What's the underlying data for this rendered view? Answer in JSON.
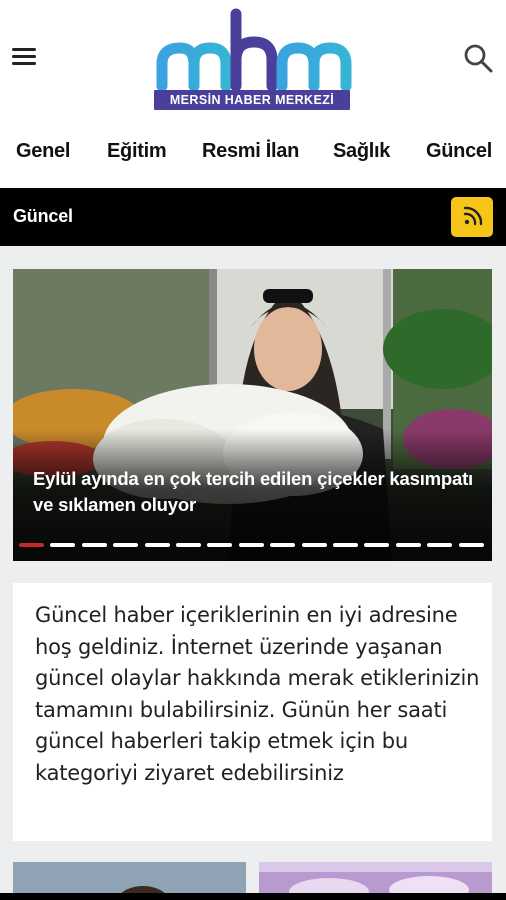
{
  "header": {
    "menu_icon": "hamburger-menu-icon",
    "search_icon": "search-icon",
    "logo_text": "MERSİN HABER MERKEZİ",
    "brand_colors": {
      "purple": "#4b3f9c",
      "blue": "#3aa3e0"
    }
  },
  "nav": {
    "items": [
      {
        "label": "Genel"
      },
      {
        "label": "Eğitim"
      },
      {
        "label": "Resmi İlan"
      },
      {
        "label": "Sağlık"
      },
      {
        "label": "Güncel"
      }
    ]
  },
  "category": {
    "title": "Güncel",
    "rss_icon": "rss-feed-icon",
    "accent": "#f5c518"
  },
  "slider": {
    "headline": "Eylül ayında en çok tercih edilen çiçekler kasımpatı ve sıklamen oluyor",
    "slide_count": 15,
    "active_index": 0,
    "active_color": "#c62828"
  },
  "description": {
    "text": "Güncel haber içeriklerinin en iyi adresine hoş geldiniz. İnternet üzerinde yaşanan güncel olaylar hakkında merak etiklerinizin tamamını bulabilirsiniz. Günün her saati güncel haberleri takip etmek için bu kategoriyi ziyaret edebilirsiniz"
  }
}
